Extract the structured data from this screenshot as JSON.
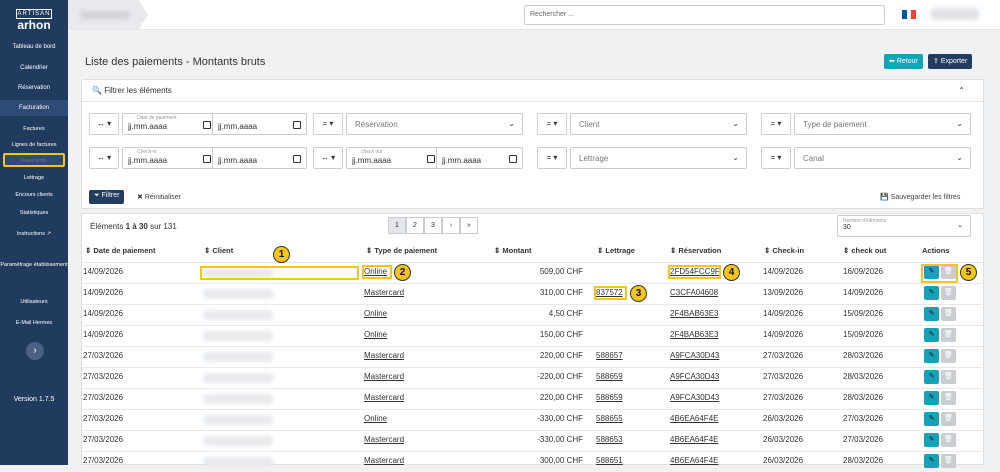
{
  "logo": {
    "mark": "ARTISAN",
    "name": "arhon"
  },
  "sidebar": {
    "items": [
      "Tableau de bord",
      "Calendrier",
      "Réservation",
      "Facturation",
      "Factures",
      "Lignes de factures",
      "Paiements",
      "Lettrage",
      "Encours clients",
      "Statistiques",
      "Instructions",
      "Paramétrage établissement",
      "Utilisateurs",
      "E-Mail Hermes"
    ],
    "expand_icon": "›",
    "version": "Version 1.7.5"
  },
  "search": {
    "placeholder": "Rechercher ..."
  },
  "page": {
    "title": "Liste des paiements - Montants bruts",
    "back": "Retour",
    "export": "Exporter"
  },
  "filters": {
    "header": "Filtrer les éléments",
    "date_paiement_label": "Date de paiement",
    "checkin_label": "Check-in",
    "checkout_label": "check out",
    "date_placeholder": "jj.mm.aaaa",
    "reservation": "Réservation",
    "client": "Client",
    "type_paiement": "Type de paiement",
    "lettrage": "Lettrage",
    "canal": "Canal",
    "filter_btn": "Filtrer",
    "reset_btn": "Réinitialiser",
    "save_btn": "Sauvegarder les filtres"
  },
  "table": {
    "count_prefix": "Éléments",
    "count_range": "1 à 30",
    "count_suffix": "sur 131",
    "pages": [
      "1",
      "2",
      "3",
      "›",
      "»"
    ],
    "per_page_label": "Nombre d'éléments",
    "per_page": "30",
    "headers": [
      "Date de paiement",
      "Client",
      "Type de paiement",
      "Montant",
      "Lettrage",
      "Réservation",
      "Check-in",
      "check out",
      "Actions"
    ],
    "rows": [
      [
        "14/09/2026",
        "Online",
        "509,00 CHF",
        "",
        "2FD54FCC9F",
        "14/09/2026",
        "16/09/2026"
      ],
      [
        "14/09/2026",
        "Mastercard",
        "310,00 CHF",
        "837572",
        "C3CFA04608",
        "13/09/2026",
        "14/09/2026"
      ],
      [
        "14/09/2026",
        "Online",
        "4,50 CHF",
        "",
        "2F4BAB63E3",
        "14/09/2026",
        "15/09/2026"
      ],
      [
        "14/09/2026",
        "Online",
        "150,00 CHF",
        "",
        "2F4BAB63E3",
        "14/09/2026",
        "15/09/2026"
      ],
      [
        "27/03/2026",
        "Mastercard",
        "220,00 CHF",
        "588657",
        "A9FCA30D43",
        "27/03/2026",
        "28/03/2026"
      ],
      [
        "27/03/2026",
        "Mastercard",
        "-220,00 CHF",
        "588659",
        "A9FCA30D43",
        "27/03/2026",
        "28/03/2026"
      ],
      [
        "27/03/2026",
        "Mastercard",
        "220,00 CHF",
        "588659",
        "A9FCA30D43",
        "27/03/2026",
        "28/03/2026"
      ],
      [
        "27/03/2026",
        "Online",
        "-330,00 CHF",
        "588655",
        "4B6EA64F4E",
        "26/03/2026",
        "27/03/2026"
      ],
      [
        "27/03/2026",
        "Mastercard",
        "-330,00 CHF",
        "588653",
        "4B6EA64F4E",
        "26/03/2026",
        "27/03/2026"
      ],
      [
        "27/03/2026",
        "Mastercard",
        "300,00 CHF",
        "588651",
        "4B6EA64F4E",
        "26/03/2026",
        "28/03/2026"
      ]
    ]
  },
  "annotations": [
    "1",
    "2",
    "3",
    "4",
    "5"
  ]
}
